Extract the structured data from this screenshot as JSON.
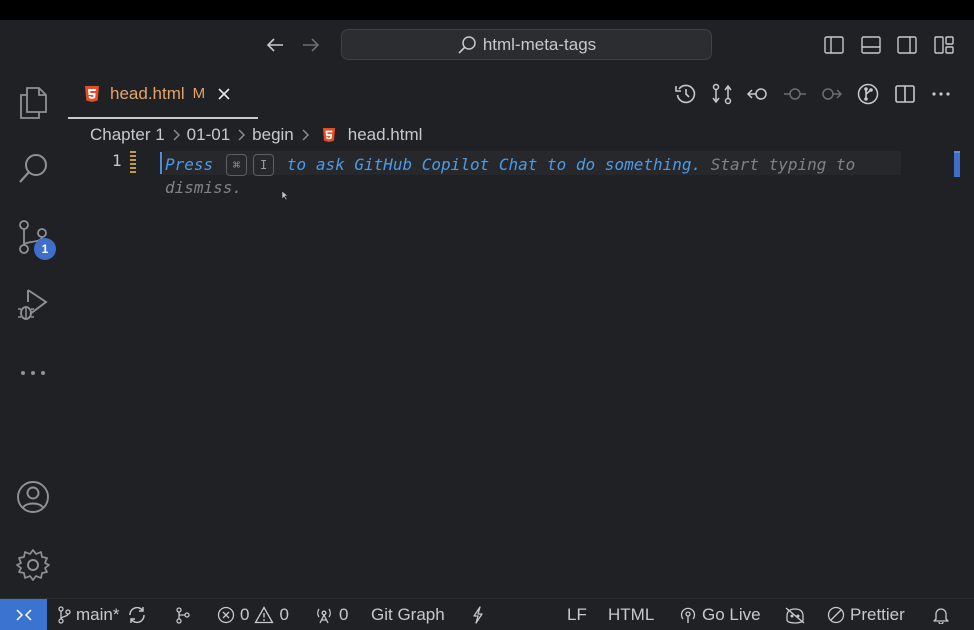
{
  "titlebar": {
    "search_text": "html-meta-tags"
  },
  "activity_bar": {
    "items": [
      {
        "name": "explorer",
        "icon": "files-icon"
      },
      {
        "name": "search",
        "icon": "search-icon"
      },
      {
        "name": "source-control",
        "icon": "source-control-icon",
        "badge": "1"
      },
      {
        "name": "run-debug",
        "icon": "run-debug-icon"
      },
      {
        "name": "more",
        "icon": "ellipsis-icon"
      },
      {
        "name": "accounts",
        "icon": "account-icon"
      },
      {
        "name": "manage",
        "icon": "gear-icon"
      }
    ]
  },
  "tab": {
    "label": "head.html",
    "modified": "M",
    "icon": "html5-icon"
  },
  "breadcrumb": {
    "items": [
      "Chapter 1",
      "01-01",
      "begin",
      "head.html"
    ]
  },
  "editor": {
    "line_number": "1",
    "hint_press": "Press",
    "hint_key1": "⌘",
    "hint_key2": "I",
    "hint_main": "to ask GitHub Copilot Chat to do something.",
    "hint_dismiss_1": "Start typing to",
    "hint_dismiss_2": "dismiss."
  },
  "statusbar": {
    "branch": "main*",
    "errors": "0",
    "warnings": "0",
    "ports": "0",
    "git_graph": "Git Graph",
    "eol": "LF",
    "language": "HTML",
    "go_live": "Go Live",
    "prettier": "Prettier"
  },
  "colors": {
    "background": "#1f2125",
    "accent_blue": "#3a73d0",
    "tab_modified": "#e3a46a",
    "html_icon": "#e44d26",
    "hint_blue": "#4c9be8"
  }
}
